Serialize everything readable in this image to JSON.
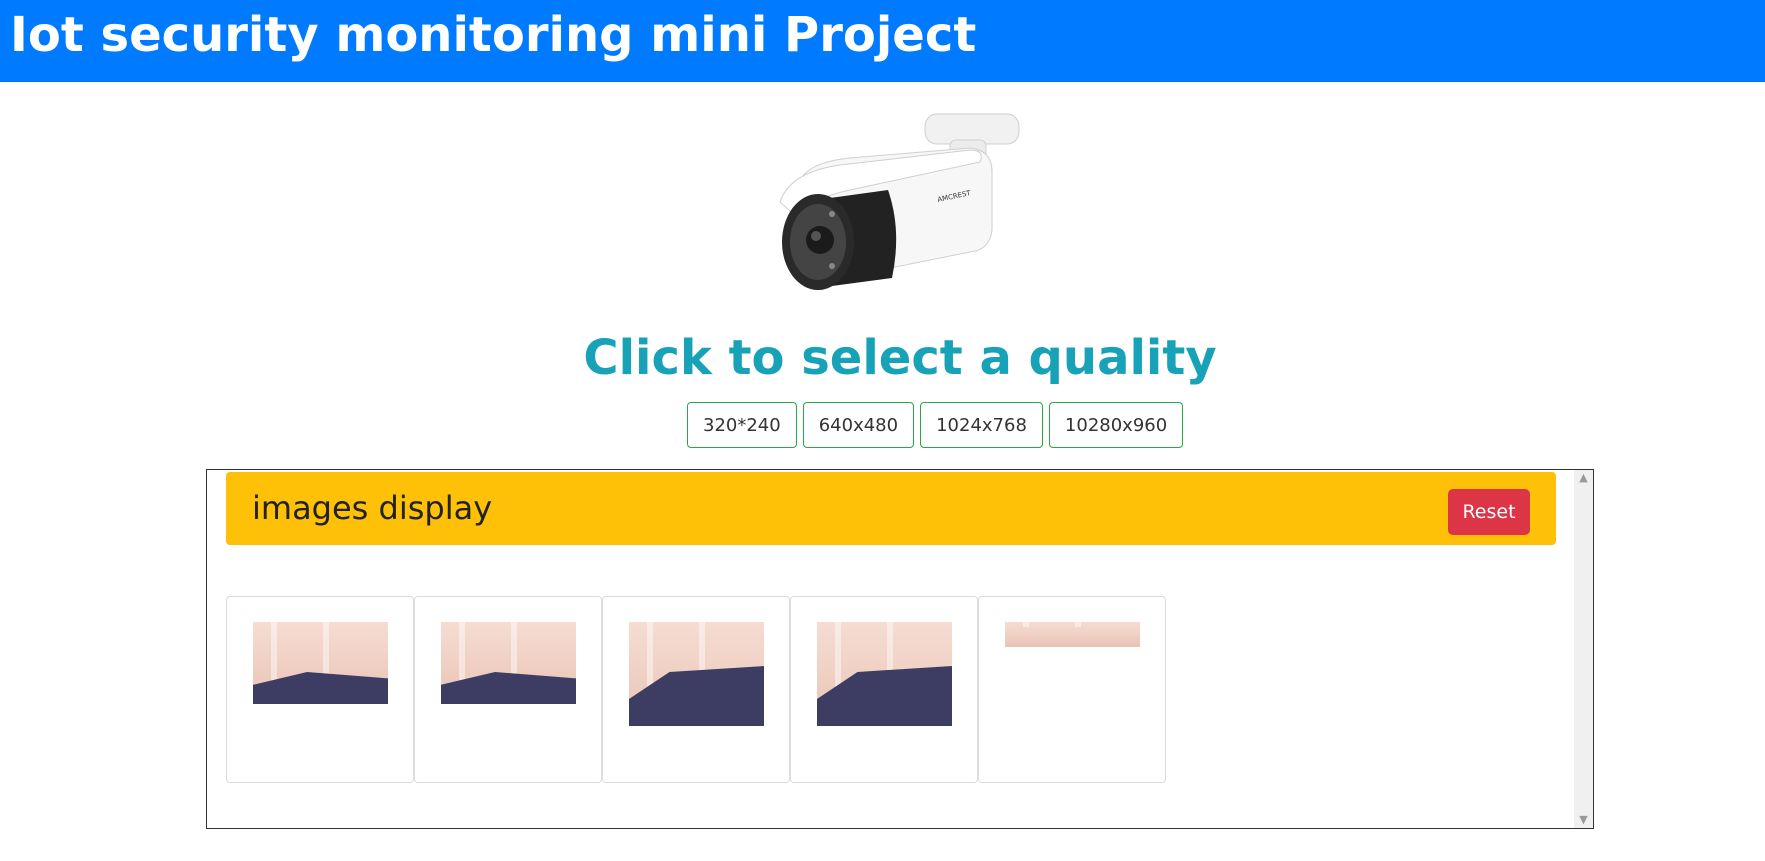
{
  "header": {
    "title": "Iot security monitoring mini Project"
  },
  "camera_image": {
    "icon": "security-camera-icon"
  },
  "quality": {
    "heading": "Click to select a quality",
    "options": [
      "320*240",
      "640x480",
      "1024x768",
      "10280x960"
    ]
  },
  "panel": {
    "title": "images display",
    "reset_label": "Reset",
    "thumbnails": [
      {
        "icon": "snapshot-thumbnail"
      },
      {
        "icon": "snapshot-thumbnail"
      },
      {
        "icon": "snapshot-thumbnail"
      },
      {
        "icon": "snapshot-thumbnail"
      },
      {
        "icon": "snapshot-thumbnail"
      }
    ]
  },
  "colors": {
    "header_bg": "#007bff",
    "heading": "#17a2b8",
    "option_border": "#28a745",
    "panel_header_bg": "#ffc107",
    "reset_bg": "#dc3545"
  }
}
